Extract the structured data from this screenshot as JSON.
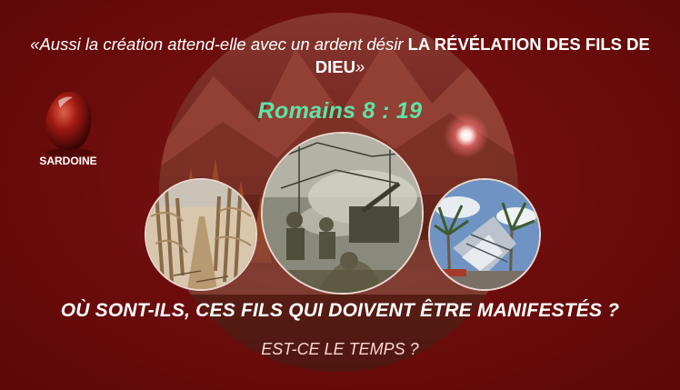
{
  "quote": {
    "open": "«",
    "intro": "Aussi la création attend-elle avec un ardent désir ",
    "emphasis": "LA RÉVÉLATION DES FILS DE DIEU",
    "close": "»"
  },
  "reference": "Romains 8 : 19",
  "gem": {
    "label": "SARDOINE",
    "icon": "sardonyx-gem-icon",
    "color": "#a01a12"
  },
  "photos": [
    {
      "name": "withered-cornfield-photo"
    },
    {
      "name": "soldiers-artillery-photo"
    },
    {
      "name": "storm-damaged-building-photo"
    }
  ],
  "question": "OÙ SONT-ILS, CES FILS QUI DOIVENT ÊTRE MANIFESTÉS ?",
  "subtitle": "EST-CE LE TEMPS ?",
  "colors": {
    "background": "#6e0b0b",
    "reference": "#5fe3a6",
    "text": "#ffffff"
  }
}
